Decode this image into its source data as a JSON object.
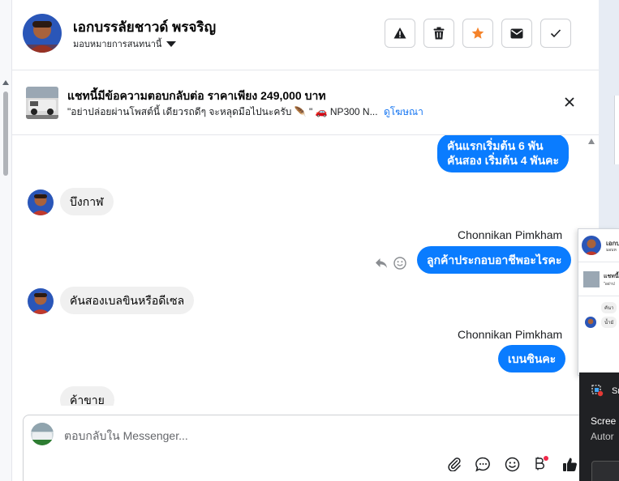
{
  "header": {
    "contact_name": "เอกบรรลัยชาวด์ พรจริญ",
    "assign_label": "มอบหมายการสนทนานี้",
    "actions": [
      "warning-icon",
      "trash-icon",
      "star-icon",
      "mail-icon",
      "check-icon"
    ],
    "star_color": "#f5832a"
  },
  "ad": {
    "title": "แชทนี้มีข้อความตอบกลับต่อ ราคาเพียง 249,000 บาท",
    "subtitle": "\"อย่าปล่อยผ่านโพสต์นี้ เดียวรถดีๆ จะหลุดมือไปนะครับ 🪶 \" 🚗 NP300 N...",
    "link": "ดูโฆษณา"
  },
  "messages": [
    {
      "dir": "out",
      "lines": [
        "คันแรกเริ่มต้น 6 พัน",
        "คันสอง เริ่มต้น 4 พันคะ"
      ]
    },
    {
      "dir": "in",
      "text": "บึงกาฬ"
    },
    {
      "dir": "out",
      "sender": "Chonnikan Pimkham",
      "text": "ลูกค้าประกอบอาชีพอะไรคะ"
    },
    {
      "dir": "in",
      "text": "คันสองเบลขินหรือดีเซล"
    },
    {
      "dir": "out",
      "sender": "Chonnikan Pimkham",
      "text": "เบนซินคะ"
    },
    {
      "dir": "in",
      "text": "ค้าขาย"
    }
  ],
  "composer": {
    "placeholder": "ตอบกลับใน Messenger...",
    "tools": [
      "attach-icon",
      "saved-reply-icon",
      "emoji-icon",
      "bitcoin-icon",
      "like-icon"
    ]
  },
  "overlay": {
    "popup_name": "เอกบ",
    "popup_sub": "มอบห",
    "popup_ad": "แชทนี้",
    "popup_ad_sub": "\"อย่าป",
    "popup_msg1": "คันา",
    "popup_msg2": "น้ำมั",
    "snip_title": "Sn",
    "snip_line1": "Scree",
    "snip_line2": "Autor"
  },
  "colors": {
    "accent": "#0a7cff",
    "link": "#1877f2"
  }
}
